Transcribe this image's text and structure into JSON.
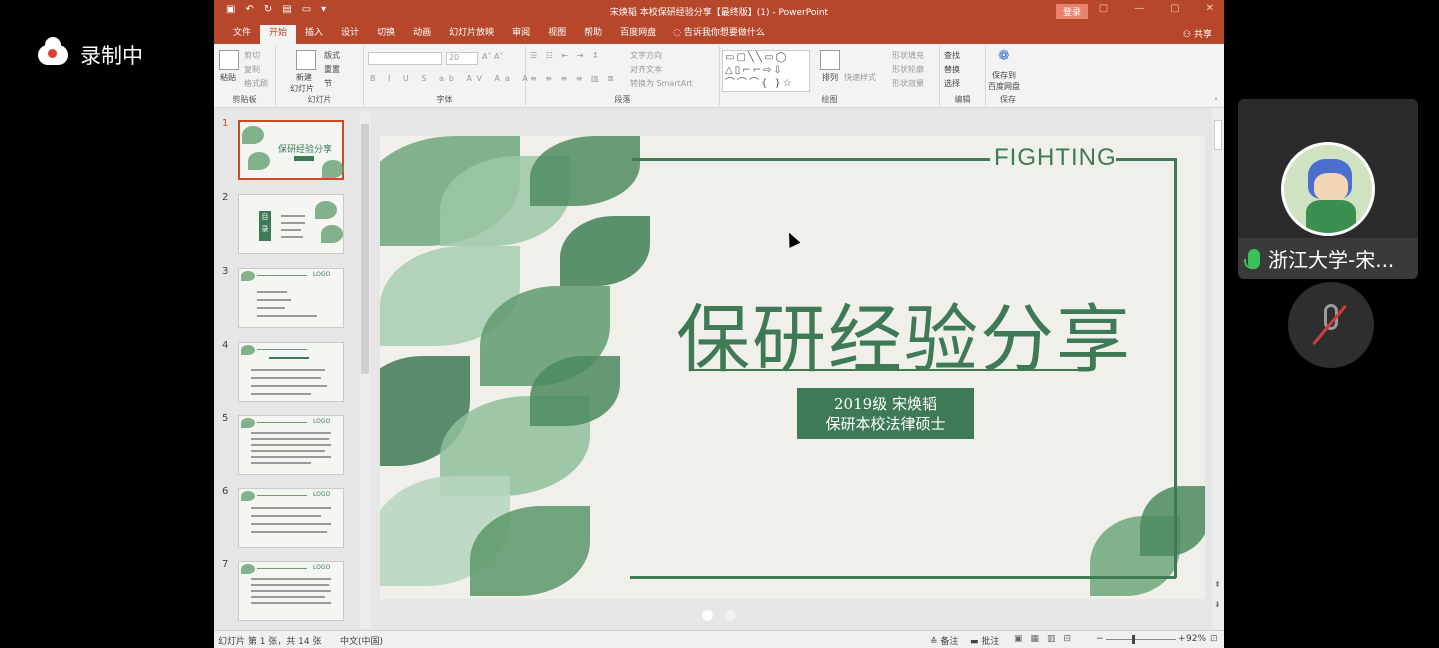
{
  "recording": {
    "label": "录制中"
  },
  "titlebar": {
    "title": "宋焕韬 本校保研经验分享【最终版】(1)  -  PowerPoint",
    "login": "登录"
  },
  "menu": {
    "tabs": [
      "文件",
      "开始",
      "插入",
      "设计",
      "切换",
      "动画",
      "幻灯片放映",
      "审阅",
      "视图",
      "帮助",
      "百度网盘"
    ],
    "tell_me": "告诉我你想要做什么",
    "share": "共享"
  },
  "ribbon": {
    "paste": "粘贴",
    "cut": "剪切",
    "copy": "复制",
    "format_painter": "格式刷",
    "new_slide": "新建",
    "new_slide2": "幻灯片",
    "layout": "版式",
    "reset": "重置",
    "section": "节",
    "font_size": "20",
    "text_direction": "文字方向",
    "align_text": "对齐文本",
    "smartart": "转换为 SmartArt",
    "arrange": "排列",
    "quick_styles": "快速样式",
    "shape_fill": "形状填充",
    "shape_outline": "形状轮廓",
    "shape_effects": "形状效果",
    "find": "查找",
    "replace": "替换",
    "select": "选择",
    "save_to": "保存到",
    "baidu": "百度网盘",
    "groups": {
      "clipboard": "剪贴板",
      "slides": "幻灯片",
      "font": "字体",
      "paragraph": "段落",
      "drawing": "绘图",
      "editing": "编辑",
      "save": "保存"
    }
  },
  "thumbnails": {
    "numbers": [
      "1",
      "2",
      "3",
      "4",
      "5",
      "6",
      "7"
    ],
    "t1_title": "保研经验分享",
    "t2_label": "目录",
    "logo": "LOGO"
  },
  "slide": {
    "fighting": "FIGHTING",
    "title": "保研经验分享",
    "sub1": "2019级 宋焕韬",
    "sub2": "保研本校法律硕士"
  },
  "statusbar": {
    "slide_info": "幻灯片 第 1 张，共 14 张",
    "language": "中文(中国)",
    "notes": "备注",
    "comments": "批注",
    "zoom": "92%"
  },
  "participant": {
    "name": "浙江大学-宋..."
  },
  "colors": {
    "accent": "#b7472a",
    "slide_green": "#3d7a55",
    "mic_green": "#39c15a",
    "mute_red": "#d23b3b"
  }
}
